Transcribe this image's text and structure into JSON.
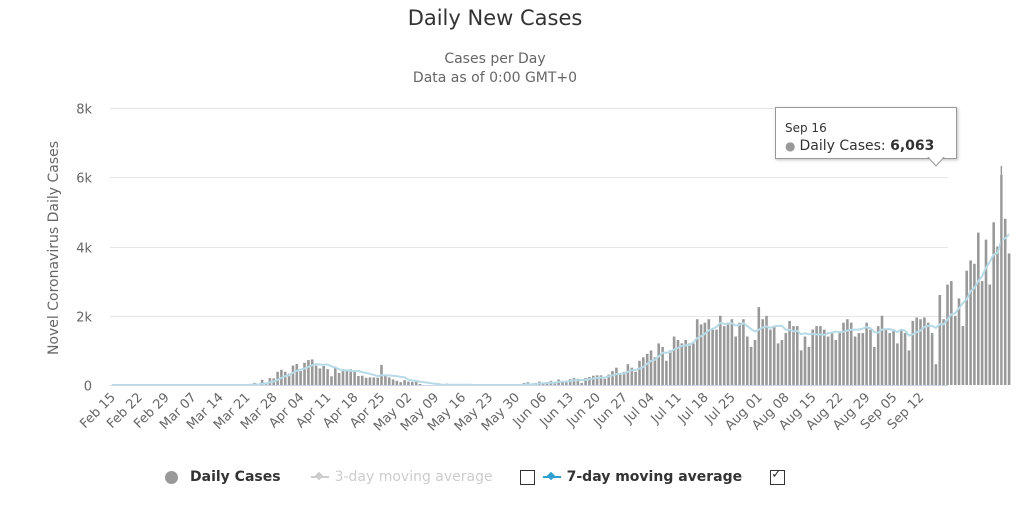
{
  "chart_data": {
    "type": "bar",
    "title": "Daily New Cases",
    "subtitle": [
      "Cases per Day",
      "Data as of 0:00 GMT+0"
    ],
    "ylabel": "Novel Coronavirus Daily Cases",
    "xlabel": "",
    "ylim": [
      0,
      8000
    ],
    "y_ticks": [
      0,
      2000,
      4000,
      6000,
      8000
    ],
    "y_tick_labels": [
      "0",
      "2k",
      "4k",
      "6k",
      "8k"
    ],
    "grid": true,
    "start_date": "Feb 15",
    "x_tick_labels": [
      "Feb 15",
      "Feb 22",
      "Feb 29",
      "Mar 07",
      "Mar 14",
      "Mar 21",
      "Mar 28",
      "Apr 04",
      "Apr 11",
      "Apr 18",
      "Apr 25",
      "May 02",
      "May 09",
      "May 16",
      "May 23",
      "May 30",
      "Jun 06",
      "Jun 13",
      "Jun 20",
      "Jun 27",
      "Jul 04",
      "Jul 11",
      "Jul 18",
      "Jul 25",
      "Aug 01",
      "Aug 08",
      "Aug 15",
      "Aug 22",
      "Aug 29",
      "Sep 05",
      "Sep 12"
    ],
    "x_tick_every_days": 7,
    "series": [
      {
        "name": "Daily Cases",
        "type": "bar",
        "color": "#999999",
        "values": [
          0,
          0,
          0,
          0,
          0,
          0,
          0,
          0,
          0,
          0,
          0,
          0,
          0,
          0,
          0,
          0,
          0,
          0,
          0,
          0,
          0,
          0,
          0,
          0,
          0,
          0,
          0,
          0,
          0,
          0,
          0,
          0,
          0,
          0,
          10,
          0,
          30,
          60,
          20,
          150,
          60,
          200,
          190,
          380,
          440,
          380,
          330,
          560,
          610,
          400,
          640,
          720,
          740,
          560,
          480,
          550,
          460,
          250,
          520,
          350,
          400,
          430,
          450,
          420,
          260,
          270,
          210,
          220,
          220,
          210,
          580,
          260,
          220,
          160,
          120,
          80,
          140,
          100,
          90,
          130,
          30,
          0,
          0,
          0,
          0,
          0,
          0,
          40,
          0,
          0,
          0,
          0,
          0,
          0,
          0,
          0,
          0,
          0,
          0,
          0,
          0,
          0,
          0,
          0,
          0,
          0,
          0,
          60,
          80,
          0,
          60,
          100,
          70,
          60,
          120,
          60,
          160,
          100,
          120,
          170,
          200,
          180,
          60,
          200,
          230,
          270,
          280,
          280,
          180,
          300,
          400,
          500,
          300,
          380,
          600,
          500,
          380,
          700,
          800,
          900,
          1000,
          800,
          1200,
          1100,
          700,
          1000,
          1400,
          1300,
          1200,
          1300,
          1200,
          1200,
          1900,
          1750,
          1800,
          1900,
          1600,
          1600,
          2000,
          1700,
          1800,
          1900,
          1400,
          1800,
          1900,
          1400,
          1100,
          1300,
          2250,
          1900,
          2000,
          1600,
          1700,
          1200,
          1300,
          1500,
          1850,
          1700,
          1700,
          1000,
          1400,
          1100,
          1600,
          1700,
          1700,
          1600,
          1400,
          1500,
          1300,
          1500,
          1800,
          1900,
          1800,
          1400,
          1500,
          1500,
          1800,
          1600,
          1100,
          1700,
          2000,
          1600,
          1500,
          1600,
          1200,
          1600,
          1500,
          1000,
          1850,
          1950,
          1900,
          1950,
          1800,
          1500,
          600,
          2600,
          1900,
          2900,
          3000,
          2000,
          2500,
          1700,
          3300,
          3600,
          3500,
          4400,
          3000,
          4200,
          2900,
          4700,
          4000,
          6063,
          4800,
          3800
        ]
      },
      {
        "name": "3-day moving average",
        "type": "line",
        "color": "#cccccc",
        "visible": false
      },
      {
        "name": "7-day moving average",
        "type": "line",
        "color": "#2f9ed1",
        "visible": true,
        "values_note": "computed from Daily Cases as 7-day trailing mean"
      }
    ],
    "tooltip": {
      "date": "Sep 16",
      "series": "Daily Cases",
      "value": 6063,
      "value_label": "6,063"
    },
    "legend_position": "bottom"
  },
  "page": {
    "title": "Daily New Cases",
    "subtitle_line1": "Cases per Day",
    "subtitle_line2": "Data as of 0:00 GMT+0"
  },
  "legend": {
    "daily_cases": "Daily Cases",
    "ma3": "3-day moving average",
    "ma7": "7-day moving average",
    "ma3_checked": false,
    "ma7_checked": true
  },
  "tooltip": {
    "date": "Sep 16",
    "label": "Daily Cases: ",
    "value": "6,063"
  },
  "colors": {
    "bar": "#999999",
    "bar_highlight": "#aaaaaa",
    "ma7": "#2f9ed1",
    "ma7_line_chart": "#b7dbe6",
    "ma3": "#cccccc",
    "grid": "#e6e6e6",
    "axis_text": "#666666"
  }
}
